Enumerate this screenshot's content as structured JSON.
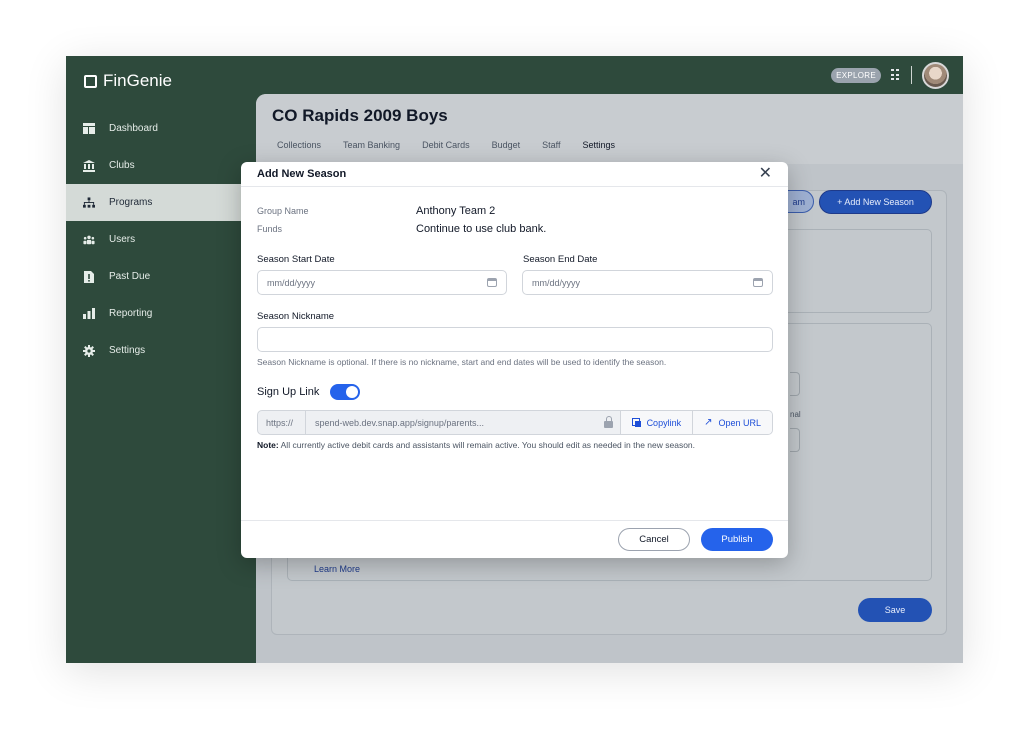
{
  "app": {
    "name": "FinGenie",
    "explore_label": "EXPLORE"
  },
  "sidebar": {
    "items": [
      {
        "label": "Dashboard",
        "icon": "dashboard-icon"
      },
      {
        "label": "Clubs",
        "icon": "bank-icon"
      },
      {
        "label": "Programs",
        "icon": "hierarchy-icon",
        "active": true
      },
      {
        "label": "Users",
        "icon": "users-icon"
      },
      {
        "label": "Past Due",
        "icon": "alert-file-icon"
      },
      {
        "label": "Reporting",
        "icon": "bar-chart-icon"
      },
      {
        "label": "Settings",
        "icon": "gear-icon"
      }
    ]
  },
  "main": {
    "title": "CO Rapids 2009 Boys",
    "tabs": [
      "Collections",
      "Team Banking",
      "Debit Cards",
      "Budget",
      "Staff",
      "Settings"
    ],
    "active_tab": "Settings",
    "partial_button_label": "am",
    "add_season_label": "+ Add New Season",
    "ghost_text": "nal",
    "learn_more_label": "Learn More",
    "save_label": "Save"
  },
  "modal": {
    "title": "Add New Season",
    "group_name_label": "Group Name",
    "group_name_value": "Anthony Team 2",
    "funds_label": "Funds",
    "funds_value": "Continue to use club bank.",
    "start_date_label": "Season Start Date",
    "start_date_placeholder": "mm/dd/yyyy",
    "end_date_label": "Season End Date",
    "end_date_placeholder": "mm/dd/yyyy",
    "nickname_label": "Season Nickname",
    "nickname_value": "",
    "nickname_helper": "Season Nickname is optional. If there is no nickname, start and end dates will be used to identify the season.",
    "signup_label": "Sign Up Link",
    "signup_enabled": true,
    "link_prefix": "https://",
    "link_url": "spend-web.dev.snap.app/signup/parents...",
    "copy_label": "Copylink",
    "open_label": "Open URL",
    "note_bold": "Note:",
    "note_text": "All currently active debit cards and assistants will remain active. You should edit as needed in the new season.",
    "cancel_label": "Cancel",
    "publish_label": "Publish"
  },
  "colors": {
    "sidebar_bg": "#2e4a3c",
    "primary": "#2563eb"
  }
}
